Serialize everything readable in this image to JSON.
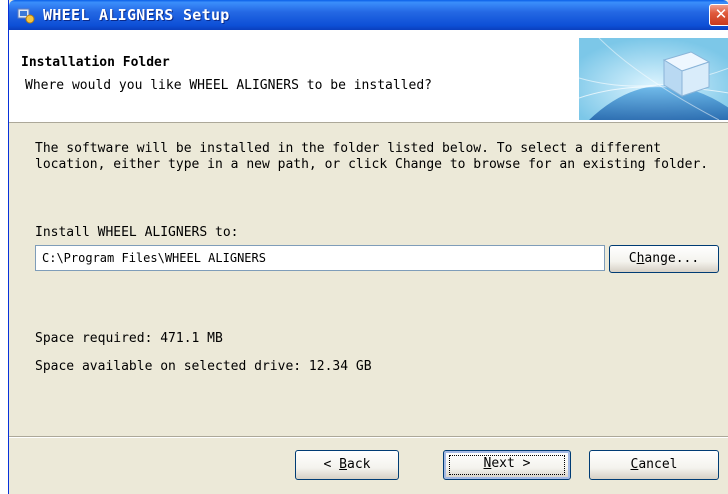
{
  "window": {
    "title": "WHEEL ALIGNERS Setup",
    "close_glyph": "✕"
  },
  "header": {
    "title": "Installation Folder",
    "subtitle": "Where would you like WHEEL ALIGNERS to be installed?"
  },
  "main": {
    "description": "The software will be installed in the folder listed below. To select a different location, either type in a new path, or click Change to browse for an existing folder.",
    "install_label": "Install WHEEL ALIGNERS to:",
    "install_path": "C:\\Program Files\\WHEEL ALIGNERS",
    "change_button": {
      "pre": "C",
      "accel": "h",
      "post": "ange..."
    },
    "space_required": "Space required: 471.1 MB",
    "space_available": "Space available on selected drive: 12.34 GB"
  },
  "footer": {
    "back_button": {
      "pre": "< ",
      "accel": "B",
      "post": "ack"
    },
    "next_button": {
      "pre": "",
      "accel": "N",
      "post": "ext >"
    },
    "cancel_button": {
      "pre": "",
      "accel": "C",
      "post": "ancel"
    }
  },
  "colors": {
    "titlebar": "#0d4fd6",
    "window_bg": "#ece9d8",
    "close": "#d7441c"
  },
  "icons": [
    "installer-app-icon",
    "close-icon",
    "header-globe-graphic"
  ]
}
